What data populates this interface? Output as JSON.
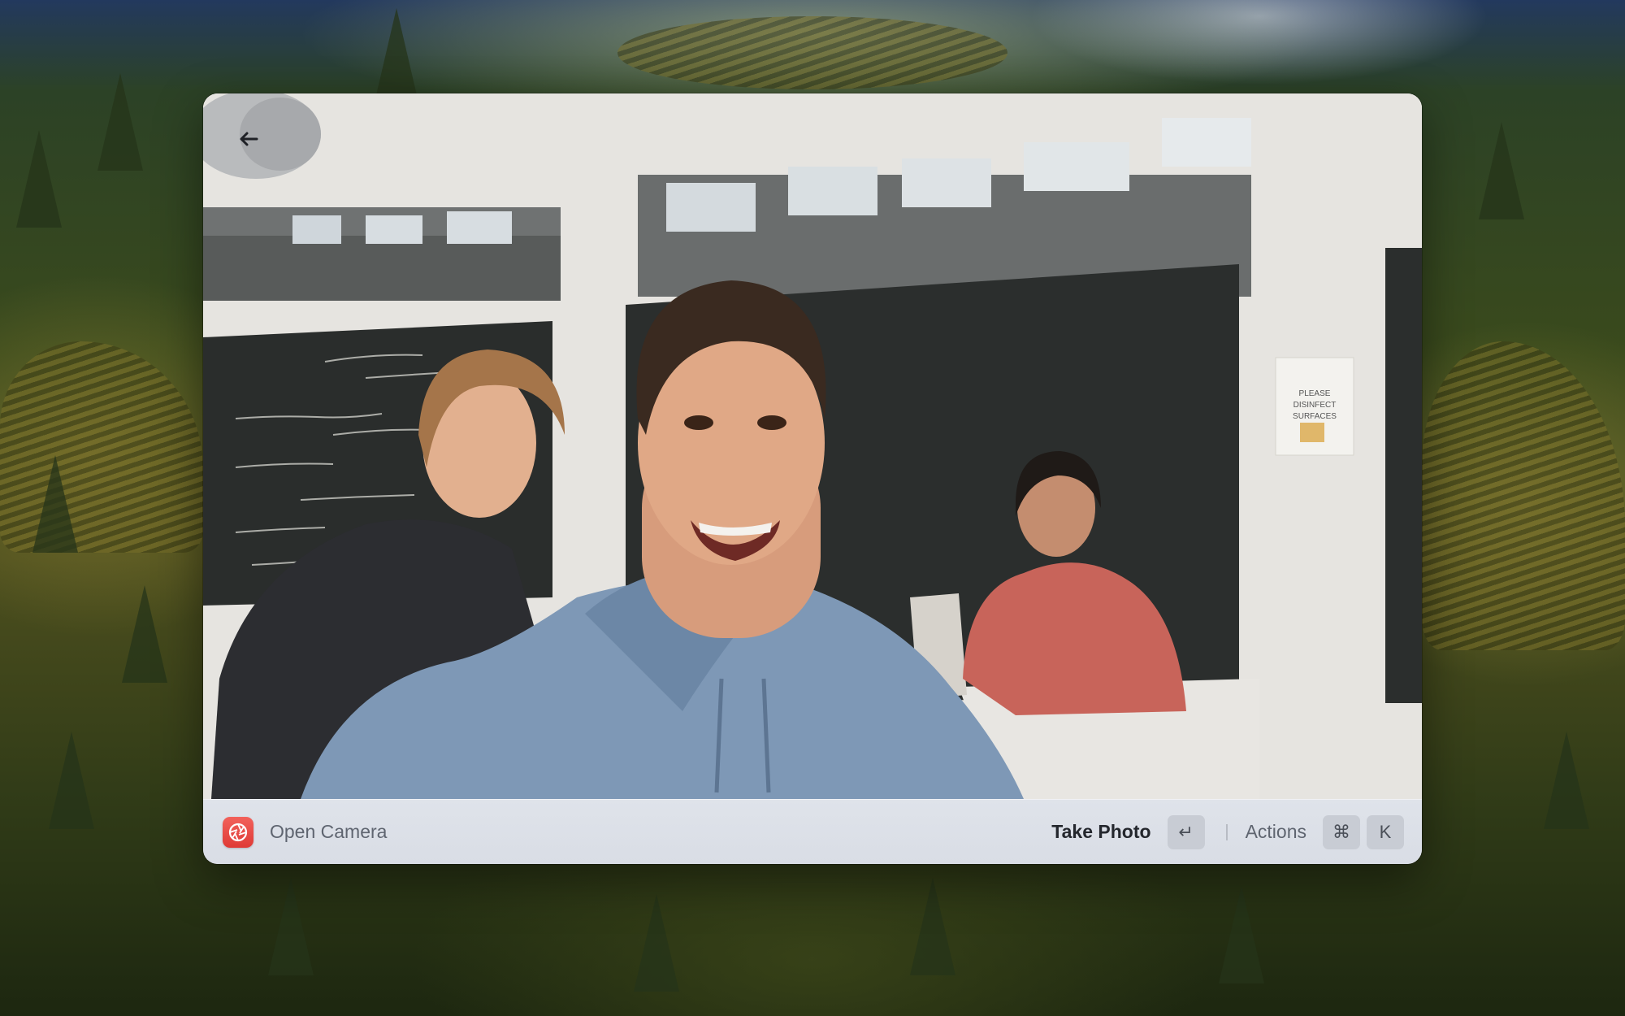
{
  "window": {
    "back_icon": "arrow-left-icon",
    "preview_alt": "Live camera preview"
  },
  "bar": {
    "app_icon": "camera-aperture-icon",
    "app_icon_color": "#e5443f",
    "title": "Open Camera",
    "primary_action": "Take Photo",
    "primary_shortcut": "↵",
    "secondary_action": "Actions",
    "secondary_shortcut": [
      "⌘",
      "K"
    ]
  },
  "scene": {
    "poster_lines": [
      "PLEASE",
      "DISINFECT",
      "SURFACES"
    ]
  }
}
